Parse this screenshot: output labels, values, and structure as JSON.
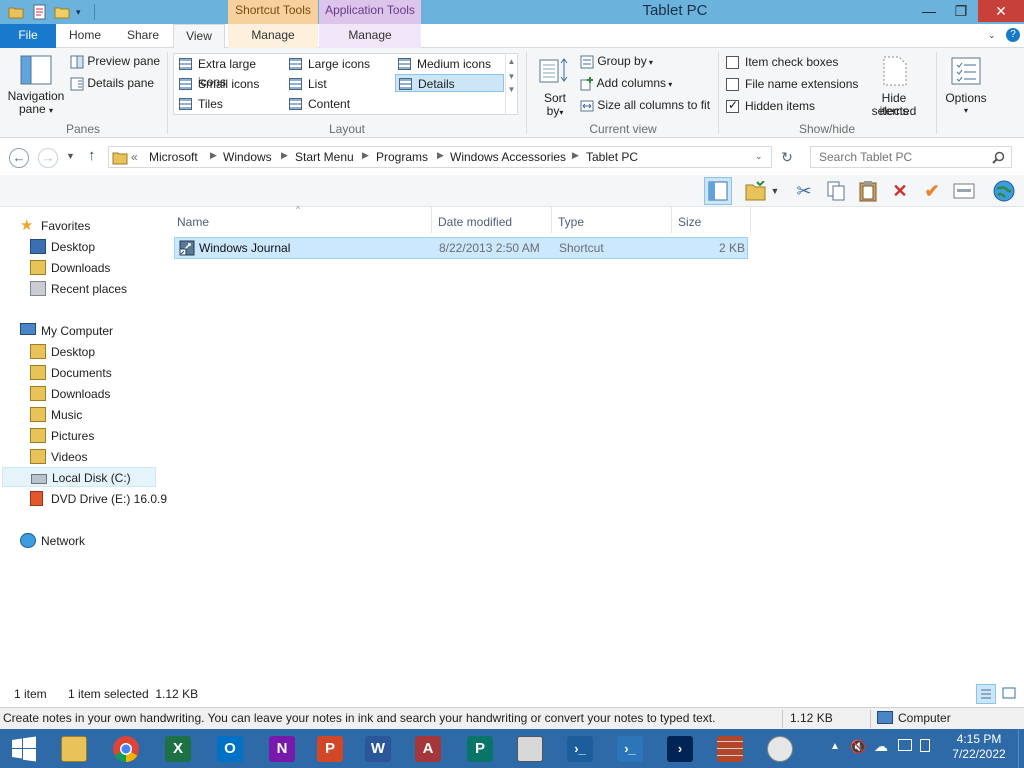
{
  "window": {
    "title": "Tablet PC",
    "context_tabs": {
      "shortcut_tools": "Shortcut Tools",
      "application_tools": "Application Tools"
    },
    "caption": {
      "minimize": "—",
      "maximize": "❐",
      "close": "✕"
    }
  },
  "ribbon_tabs": {
    "file": "File",
    "home": "Home",
    "share": "Share",
    "view": "View",
    "manage1": "Manage",
    "manage2": "Manage",
    "help": "?"
  },
  "ribbon": {
    "panes": {
      "navigation_pane": "Navigation",
      "navigation_pane_2": "pane",
      "preview_pane": "Preview pane",
      "details_pane": "Details pane",
      "label": "Panes"
    },
    "layout": {
      "items": [
        "Extra large icons",
        "Large icons",
        "Medium icons",
        "Small icons",
        "List",
        "Details",
        "Tiles",
        "Content"
      ],
      "selected": "Details",
      "label": "Layout"
    },
    "current_view": {
      "sort_by": "Sort",
      "sort_by_2": "by",
      "group_by": "Group by",
      "add_columns": "Add columns",
      "size_all_columns": "Size all columns to fit",
      "label": "Current view"
    },
    "show_hide": {
      "item_check_boxes": "Item check boxes",
      "item_check_boxes_checked": false,
      "file_name_extensions": "File name extensions",
      "file_name_extensions_checked": false,
      "hidden_items": "Hidden items",
      "hidden_items_checked": true,
      "hide_selected_items": "Hide selected",
      "hide_selected_items_2": "items",
      "label": "Show/hide"
    },
    "options": "Options"
  },
  "address": {
    "overflow": "«",
    "crumbs": [
      "Microsoft",
      "Windows",
      "Start Menu",
      "Programs",
      "Windows Accessories",
      "Tablet PC"
    ],
    "search_placeholder": "Search Tablet PC"
  },
  "navigation": {
    "favorites": "Favorites",
    "favorites_items": [
      "Desktop",
      "Downloads",
      "Recent places"
    ],
    "computer": "My Computer",
    "computer_items": [
      "Desktop",
      "Documents",
      "Downloads",
      "Music",
      "Pictures",
      "Videos",
      "Local Disk (C:)",
      "DVD Drive (E:) 16.0.9"
    ],
    "network": "Network"
  },
  "file_list": {
    "columns": [
      "Name",
      "Date modified",
      "Type",
      "Size"
    ],
    "rows": [
      {
        "name": "Windows Journal",
        "date_modified": "8/22/2013 2:50 AM",
        "type": "Shortcut",
        "size": "2 KB"
      }
    ]
  },
  "status": {
    "item_count": "1 item",
    "selection": "1 item selected  1.12 KB",
    "tip": "Create notes in your own handwriting. You can leave your notes in ink and search your handwriting or convert your notes to typed text.",
    "tip_size": "1.12 KB",
    "tip_location": "Computer"
  },
  "taskbar": {
    "apps": [
      "file-explorer",
      "chrome",
      "excel",
      "outlook",
      "onenote",
      "powerpoint",
      "word",
      "access",
      "publisher",
      "device-manager",
      "powershell",
      "powershell-ise",
      "powershell-2",
      "firewall",
      "clock-app"
    ],
    "labels": {
      "excel": "X",
      "outlook": "O",
      "onenote": "N",
      "powerpoint": "P",
      "word": "W",
      "access": "A",
      "publisher": "P"
    },
    "clock_time": "4:15 PM",
    "clock_date": "7/22/2022"
  },
  "colors": {
    "title_bar": "#6bb2dd",
    "file_tab": "#1979ca",
    "selection": "#cce8ff",
    "taskbar": "#2e6aa8",
    "close_button": "#c7403a"
  }
}
